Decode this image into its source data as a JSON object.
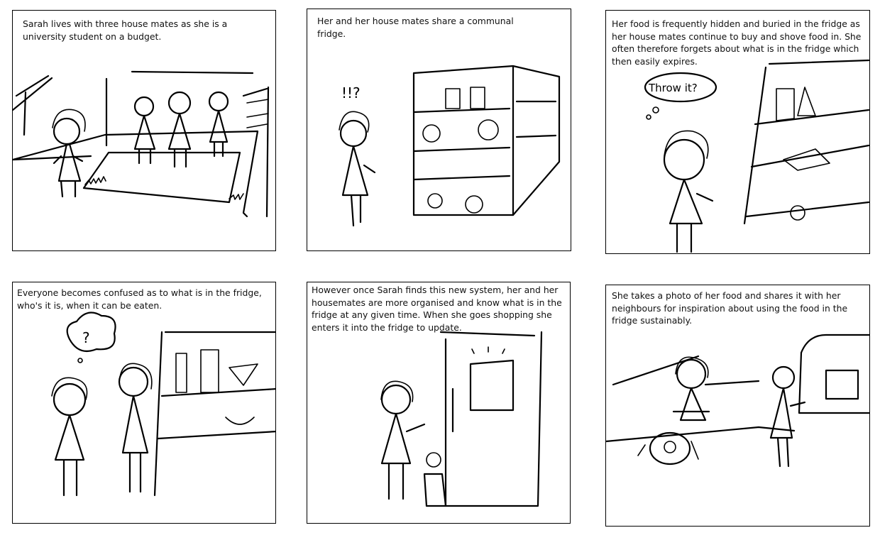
{
  "storyboard": {
    "panels": [
      {
        "caption": "Sarah lives with three house mates as she is a university student on a budget."
      },
      {
        "caption": "Her and her house mates share a communal fridge.",
        "exclaim": "!!?"
      },
      {
        "caption": "Her food is frequently hidden and buried in the fridge as her house mates continue to buy and shove food in. She often therefore forgets about what is in the fridge which then easily expires.",
        "bubble": "Throw it?"
      },
      {
        "caption": "Everyone becomes confused as to what is in the fridge, who's it is, when it can be eaten.",
        "bubble": "?"
      },
      {
        "caption": "However once Sarah finds this new system, her and her housemates are more organised and know what is in the fridge at any given time. When she goes shopping she enters it into the fridge to update."
      },
      {
        "caption": "She takes a photo of her food and shares it with her neighbours for inspiration about using the food in the fridge sustainably."
      }
    ]
  }
}
